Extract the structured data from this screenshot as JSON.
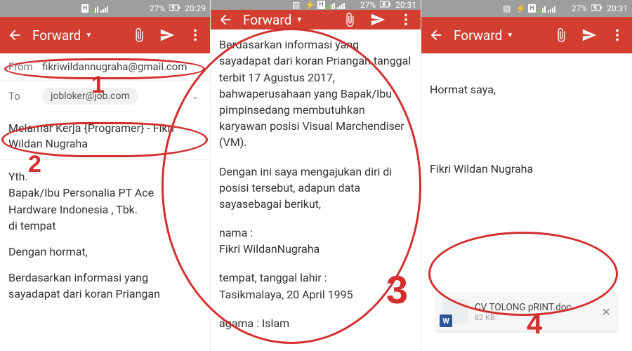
{
  "panes": [
    {
      "status": {
        "badge": "H",
        "battery": "27%",
        "time": "20:29"
      },
      "appbar": {
        "title": "Forward"
      },
      "from_label": "From",
      "from_value": "fikriwildannugraha@gmail.com",
      "to_label": "To",
      "to_value": "jobloker@job.com",
      "subject": "Melamar Kerja {Programer} - Fikri Wildan Nugraha",
      "body_p1": "Yth.",
      "body_p2": "Bapak/Ibu Personalia PT Ace Hardware Indonesia , Tbk.",
      "body_p3": "di tempat",
      "body_p4": "Dengan hormat,",
      "body_p5": "Berdasarkan informasi yang sayadapat dari koran Priangan",
      "annot1": "1",
      "annot2": "2"
    },
    {
      "status": {
        "badge": "H",
        "battery": "27%",
        "time": "20:31"
      },
      "appbar": {
        "title": "Forward"
      },
      "body_p1": "Berdasarkan informasi yang sayadapat dari koran Priangan tanggal terbit 17 Agustus 2017, bahwaperusahaan yang Bapak/Ibu pimpinsedang membutuhkan karyawan posisi Visual Marchendiser (VM).",
      "body_p2": "Dengan ini saya mengajukan diri di posisi tersebut, adapun data sayasebagai berikut,",
      "body_p3_l1": "nama                               :",
      "body_p3_l2": "Fikri WildanNugraha",
      "body_p4_l1": "tempat, tanggal lahir        :",
      "body_p4_l2": "Tasikmalaya, 20  April 1995",
      "body_p5": "agama                            : Islam",
      "annot3": "3"
    },
    {
      "status": {
        "badge": "H",
        "battery": "27%",
        "time": "20:31"
      },
      "appbar": {
        "title": "Forward"
      },
      "body_p1": "Hormat saya,",
      "body_p2": "Fikri Wildan Nugraha",
      "attachment": {
        "name": "CV TOLONG pRINT.doc",
        "size": "82 KB",
        "badge": "W"
      },
      "annot4": "4"
    }
  ]
}
